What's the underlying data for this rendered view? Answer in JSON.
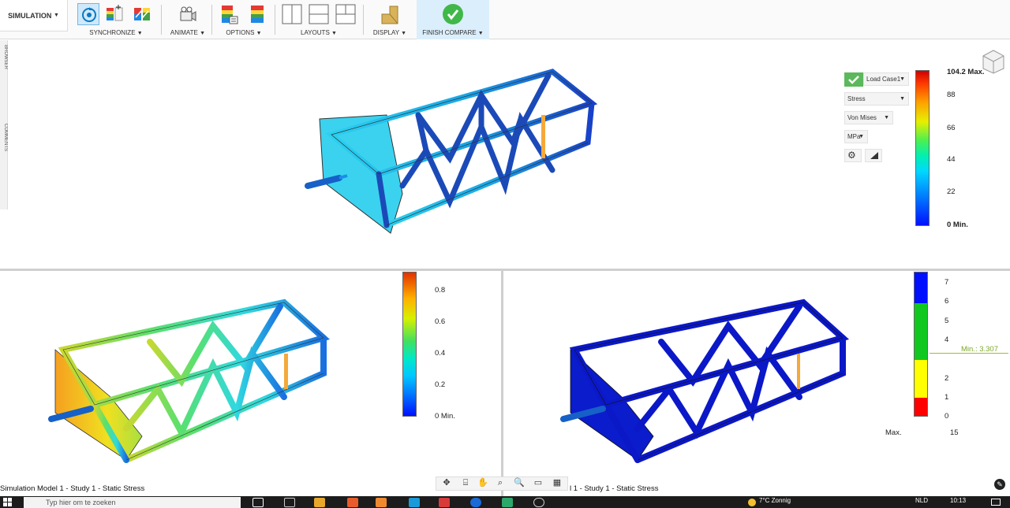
{
  "toolbar": {
    "workspace": "SIMULATION",
    "groups": {
      "synchronize": "SYNCHRONIZE",
      "animate": "ANIMATE",
      "options": "OPTIONS",
      "layouts": "LAYOUTS",
      "display": "DISPLAY",
      "finish": "FINISH COMPARE"
    }
  },
  "sidebar": {
    "browser": "BROWSER",
    "comments": "COMMENTS"
  },
  "top_panel": {
    "controls": {
      "load_case": "Load Case1",
      "result_type": "Stress",
      "component": "Von Mises",
      "unit": "MPa"
    },
    "legend": {
      "ticks": [
        "104.2 Max.",
        "88",
        "66",
        "44",
        "22",
        "0 Min."
      ]
    }
  },
  "bottom_left": {
    "legend": {
      "ticks": [
        "0.8",
        "0.6",
        "0.4",
        "0.2",
        "0 Min."
      ]
    },
    "caption": "Simulation Model 1 - Study 1 - Static Stress"
  },
  "bottom_right": {
    "legend": {
      "ticks": [
        "7",
        "6",
        "5",
        "4",
        "2",
        "1",
        "0"
      ],
      "min_marker": "Min.: 3.307",
      "max_label": "Max.",
      "max_value": "15"
    },
    "caption": "l 1 - Study 1 - Static Stress"
  },
  "taskbar": {
    "search_placeholder": "Typ hier om te zoeken",
    "weather": "7°C Zonnig",
    "language": "NLD",
    "time": "10:13"
  },
  "colors": {
    "accent": "#0696d7",
    "finish_green": "#3fb849",
    "jet_top": "#d00000",
    "jet_bottom": "#0010ff"
  }
}
